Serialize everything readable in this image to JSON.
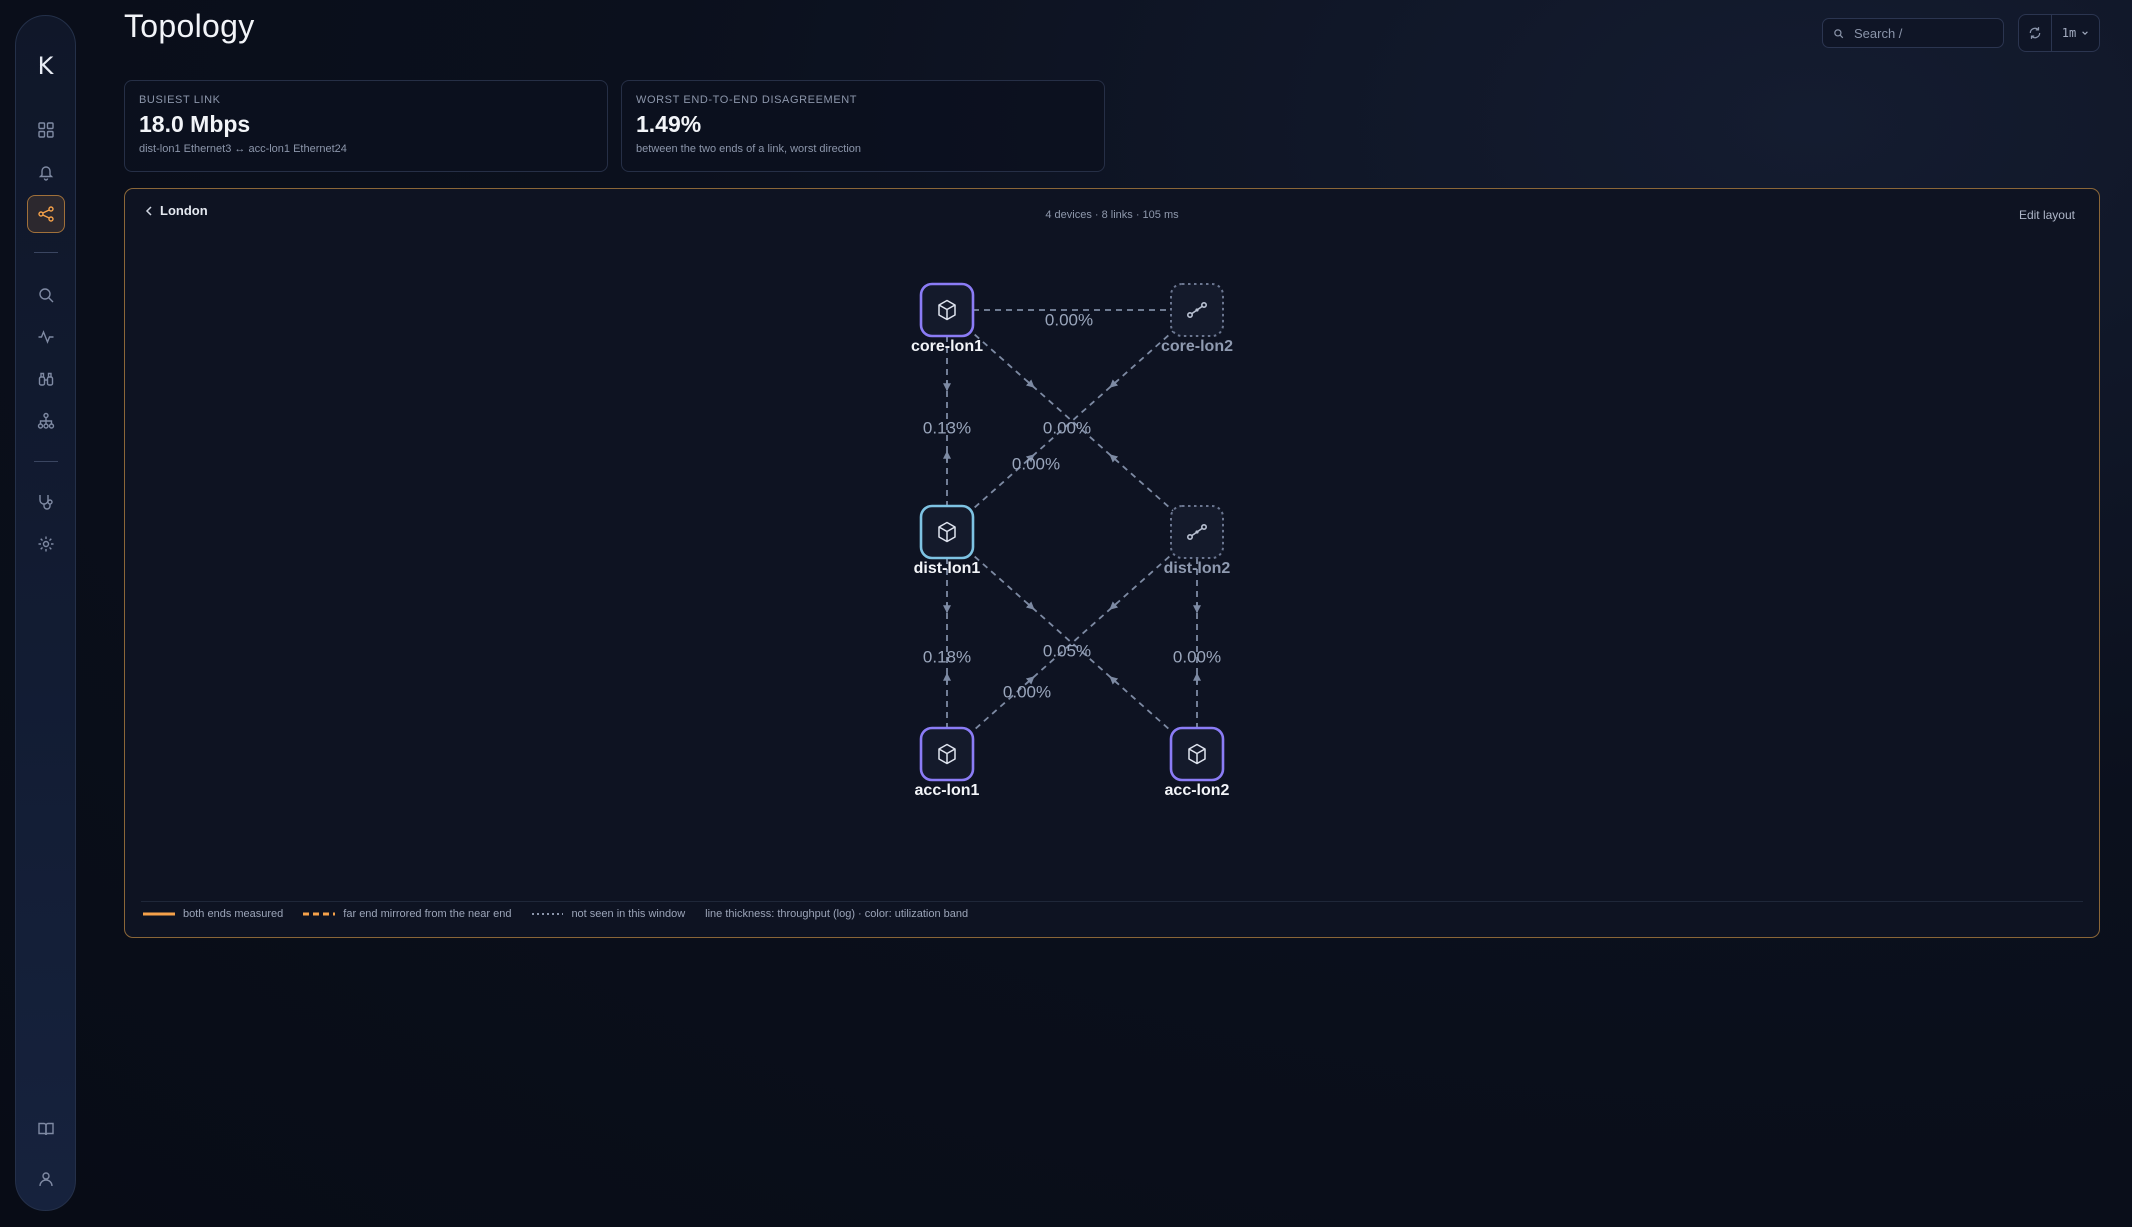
{
  "page": {
    "title": "Topology"
  },
  "header": {
    "search_placeholder": "Search /",
    "refresh_interval": "1m"
  },
  "sidebar": {
    "logo": "K",
    "items": [
      {
        "name": "dashboard",
        "icon": "grid-icon"
      },
      {
        "name": "alerts",
        "icon": "bell-icon"
      },
      {
        "name": "topology",
        "icon": "share-nodes-icon",
        "active": true
      },
      {
        "name": "search",
        "icon": "search-icon"
      },
      {
        "name": "metrics",
        "icon": "activity-icon"
      },
      {
        "name": "discovery",
        "icon": "binoculars-icon"
      },
      {
        "name": "hierarchy",
        "icon": "sitemap-icon"
      },
      {
        "name": "health",
        "icon": "stethoscope-icon"
      },
      {
        "name": "settings",
        "icon": "gear-icon"
      },
      {
        "name": "docs",
        "icon": "book-icon"
      },
      {
        "name": "account",
        "icon": "user-icon"
      }
    ]
  },
  "stats": [
    {
      "label": "BUSIEST LINK",
      "value": "18.0 Mbps",
      "sub": "dist-lon1 Ethernet3 ↔ acc-lon1 Ethernet24"
    },
    {
      "label": "WORST END-TO-END DISAGREEMENT",
      "value": "1.49%",
      "sub": "between the two ends of a link, worst direction"
    }
  ],
  "topology": {
    "site": "London",
    "meta": "4 devices · 8 links · 105 ms",
    "edit_label": "Edit layout",
    "colors": {
      "edge": "#7d8aa3",
      "edge_label": "#9aa6bc",
      "node_purple": "#8b7cf6",
      "node_blue": "#7ec3e3",
      "node_ghost": "#6b7690",
      "accent": "#f5a14a"
    },
    "nodes": [
      {
        "id": "core-lon1",
        "label": "core-lon1",
        "kind": "device",
        "style": "purple",
        "seen": true
      },
      {
        "id": "core-lon2",
        "label": "core-lon2",
        "kind": "unseen",
        "style": "ghost",
        "seen": false
      },
      {
        "id": "dist-lon1",
        "label": "dist-lon1",
        "kind": "device",
        "style": "blue",
        "seen": true
      },
      {
        "id": "dist-lon2",
        "label": "dist-lon2",
        "kind": "unseen",
        "style": "ghost",
        "seen": false
      },
      {
        "id": "acc-lon1",
        "label": "acc-lon1",
        "kind": "device",
        "style": "purple",
        "seen": true
      },
      {
        "id": "acc-lon2",
        "label": "acc-lon2",
        "kind": "device",
        "style": "purple",
        "seen": true
      }
    ],
    "edges": [
      {
        "from": "core-lon1",
        "to": "core-lon2",
        "label": "0.00%"
      },
      {
        "from": "core-lon1",
        "to": "dist-lon1",
        "label": "0.13%"
      },
      {
        "from": "core-lon1",
        "to": "dist-lon2",
        "label": "0.00%"
      },
      {
        "from": "dist-lon1",
        "to": "core-lon2",
        "label": "0.00%"
      },
      {
        "from": "dist-lon1",
        "to": "acc-lon1",
        "label": "0.18%"
      },
      {
        "from": "dist-lon1",
        "to": "acc-lon2",
        "label": "0.05%"
      },
      {
        "from": "dist-lon2",
        "to": "acc-lon1",
        "label": "0.00%"
      },
      {
        "from": "dist-lon2",
        "to": "acc-lon2",
        "label": "0.00%"
      }
    ]
  },
  "legend": {
    "both": "both ends measured",
    "mirrored": "far end mirrored from the near end",
    "unseen": "not seen in this window",
    "note": "line thickness: throughput (log) · color: utilization band"
  }
}
